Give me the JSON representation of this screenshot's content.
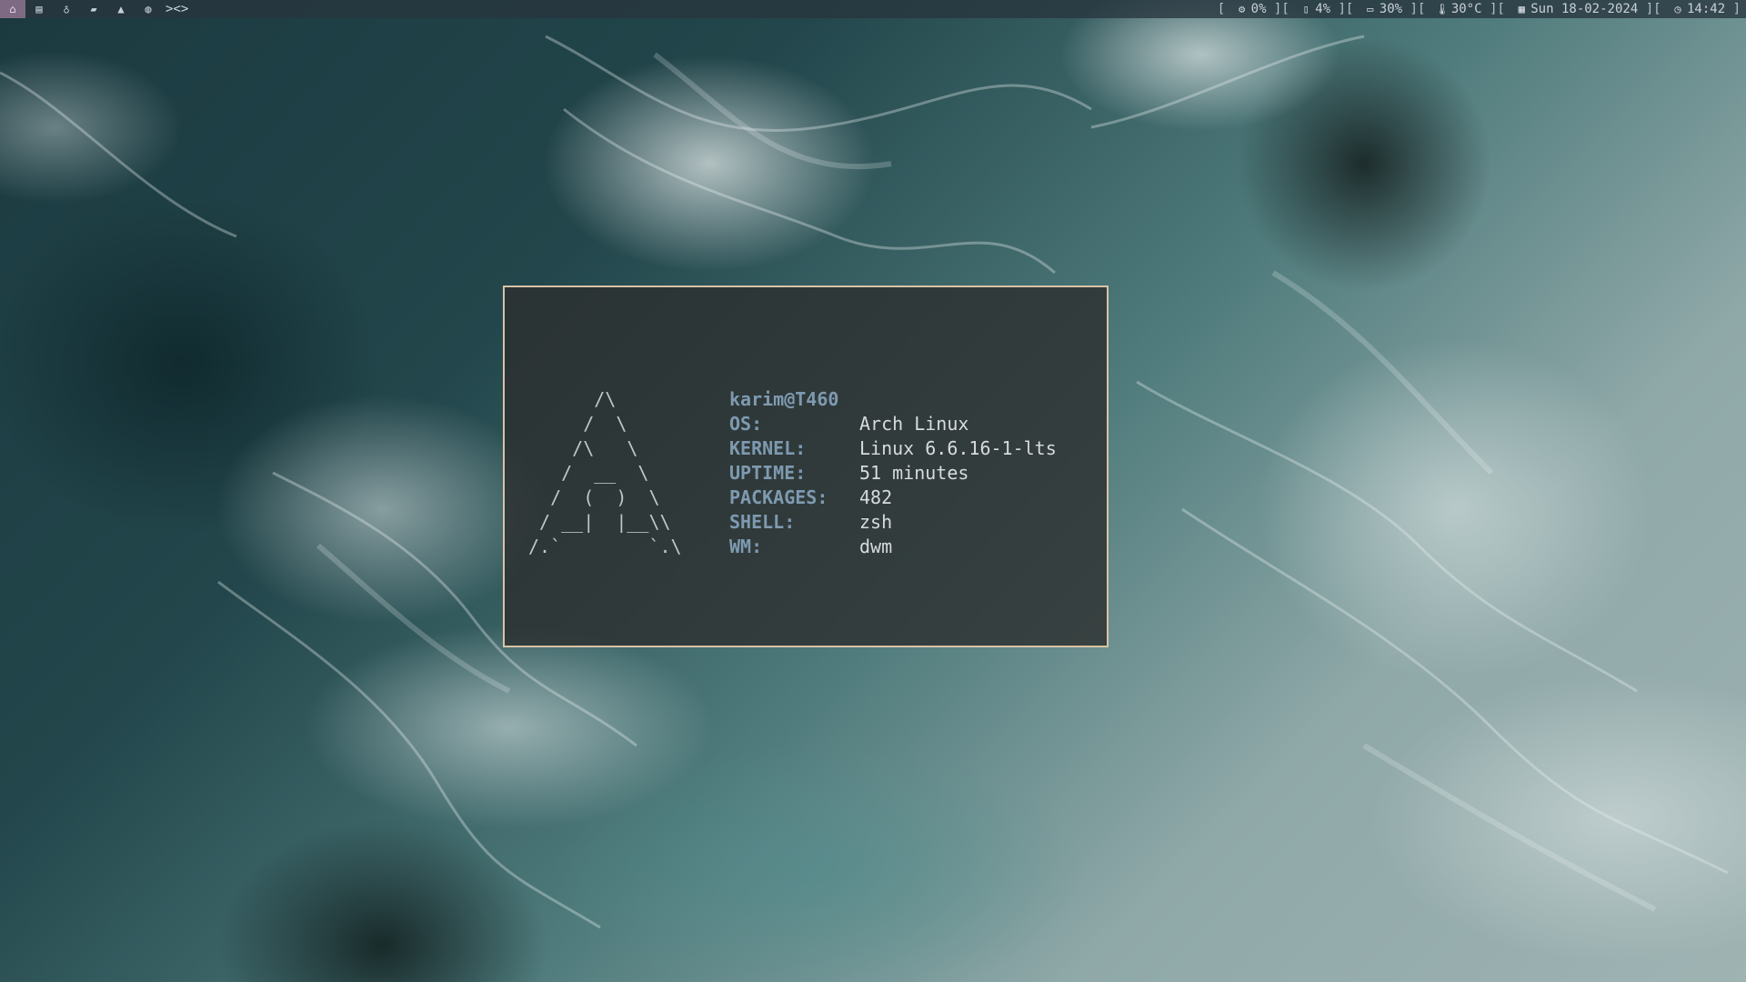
{
  "topbar": {
    "tags": [
      {
        "icon": "home-icon",
        "glyph": "⌂",
        "active": true
      },
      {
        "icon": "book-icon",
        "glyph": "▤",
        "active": false
      },
      {
        "icon": "flask-icon",
        "glyph": "♁",
        "active": false
      },
      {
        "icon": "folder-open-icon",
        "glyph": "▰",
        "active": false
      },
      {
        "icon": "graduation-cap-icon",
        "glyph": "▲",
        "active": false
      },
      {
        "icon": "globe-icon",
        "glyph": "◍",
        "active": false
      }
    ],
    "layout_symbol": "><>",
    "status": {
      "cpu": "0%",
      "disk": "4%",
      "battery": "30%",
      "temp": "30°C",
      "date": "Sun 18-02-2024",
      "time": "14:42"
    }
  },
  "terminal": {
    "ascii_logo": "      /\\\n     /  \\\n    /\\   \\\n   /  __  \\\n  /  (  )  \\\n / __|  |__\\\\\n/.`        `.\\",
    "host": "karim@T460",
    "info": [
      {
        "key": "OS:",
        "value": "Arch Linux"
      },
      {
        "key": "KERNEL:",
        "value": "Linux 6.6.16-1-lts"
      },
      {
        "key": "UPTIME:",
        "value": "51 minutes"
      },
      {
        "key": "PACKAGES:",
        "value": "482"
      },
      {
        "key": "SHELL:",
        "value": "zsh"
      },
      {
        "key": "WM:",
        "value": "dwm"
      }
    ]
  },
  "colors": {
    "bar_bg": "#28343e",
    "active_tag": "#7e6a83",
    "terminal_border": "#d8c3a6",
    "label": "#7e9ab0"
  }
}
